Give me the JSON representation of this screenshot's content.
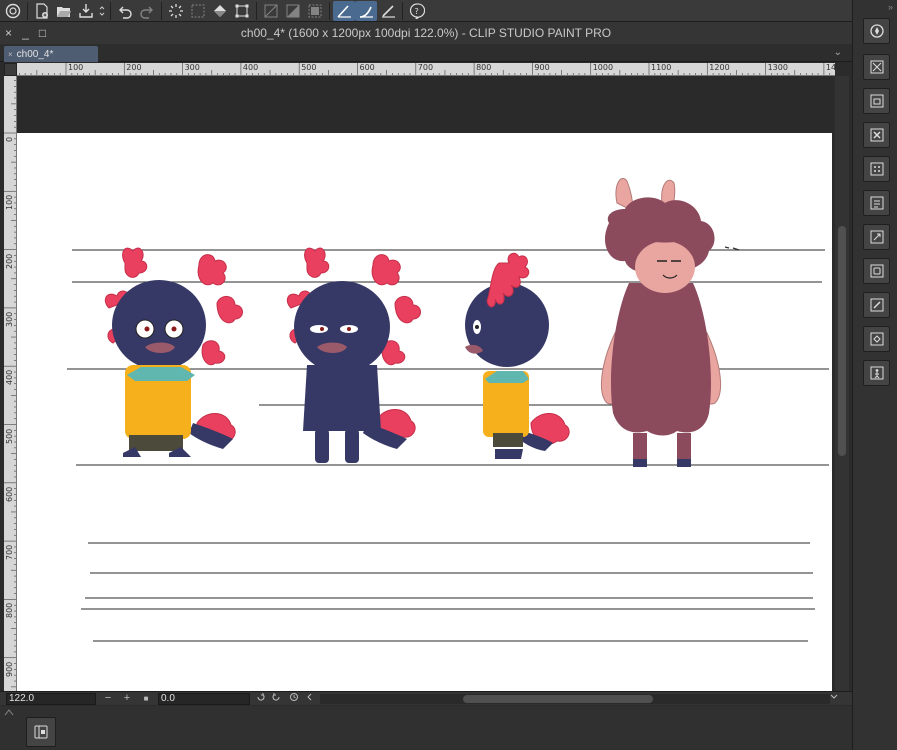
{
  "window": {
    "title": "ch00_4* (1600 x 1200px 100dpi 122.0%)  - CLIP STUDIO PAINT PRO",
    "close": "×",
    "minimize": "_",
    "maximize": "□"
  },
  "tab": {
    "label": "ch00_4*",
    "close": "×",
    "menu": "⌄"
  },
  "ruler_top": [
    "100",
    "200",
    "300",
    "400",
    "500",
    "600",
    "700",
    "800",
    "900",
    "1000",
    "1100",
    "1200",
    "1300",
    "140"
  ],
  "ruler_left": [
    "0",
    "100",
    "200",
    "300",
    "400",
    "500",
    "600",
    "700",
    "800",
    "900"
  ],
  "status": {
    "zoom": "122.0",
    "zoom_out": "−",
    "zoom_in": "+",
    "fit": "■",
    "rotation": "0.0"
  },
  "right_panel": {
    "collapse": "»"
  },
  "colors": {
    "axolotl_body": "#363866",
    "gills": "#e8405e",
    "jacket": "#f5b01c",
    "scarf": "#5fb7b0",
    "llama_wool": "#8c4a5d",
    "llama_skin": "#e9a59f",
    "tab_active": "#4e5d72",
    "tool_active": "#4b6a8f"
  },
  "icons": {
    "toolbar": [
      "clip-studio-icon",
      "new-file-icon",
      "open-file-icon",
      "save-icon",
      "undo-icon",
      "redo-icon",
      "clear-selection-icon",
      "select-all-icon",
      "fill-icon",
      "transform-icon",
      "hide-outside-icon",
      "clear-icon",
      "fill-selection-icon",
      "snap-ruler-icon",
      "snap-special-ruler-icon",
      "snap-grid-icon",
      "help-icon"
    ],
    "right_panel": [
      "navigator-icon",
      "layer-property-icon",
      "layer-folder-icon",
      "delete-layer-icon",
      "tone-icon",
      "layer-mask-icon",
      "transform-layer-icon",
      "material-icon",
      "edit-icon",
      "export-icon",
      "figure-icon"
    ]
  }
}
